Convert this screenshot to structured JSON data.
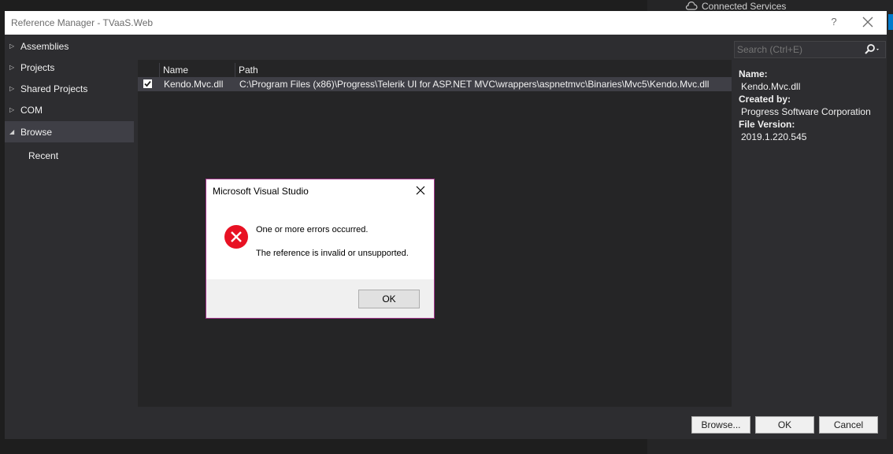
{
  "background": {
    "connected_services": "Connected Services"
  },
  "window": {
    "title": "Reference Manager - TVaaS.Web",
    "help": "?"
  },
  "nav": {
    "items": [
      {
        "label": "Assemblies",
        "expanded": false
      },
      {
        "label": "Projects",
        "expanded": false
      },
      {
        "label": "Shared Projects",
        "expanded": false
      },
      {
        "label": "COM",
        "expanded": false
      },
      {
        "label": "Browse",
        "expanded": true,
        "selected": true
      }
    ],
    "sub_items": [
      "Recent"
    ]
  },
  "list": {
    "columns": [
      "Name",
      "Path"
    ],
    "rows": [
      {
        "checked": true,
        "name": "Kendo.Mvc.dll",
        "path": "C:\\Program Files (x86)\\Progress\\Telerik UI for ASP.NET MVC\\wrappers\\aspnetmvc\\Binaries\\Mvc5\\Kendo.Mvc.dll"
      }
    ]
  },
  "search": {
    "placeholder": "Search (Ctrl+E)"
  },
  "details": {
    "name_label": "Name:",
    "name_value": "Kendo.Mvc.dll",
    "created_label": "Created by:",
    "created_value": "Progress Software Corporation",
    "version_label": "File Version:",
    "version_value": "2019.1.220.545"
  },
  "buttons": {
    "browse": "Browse...",
    "ok": "OK",
    "cancel": "Cancel"
  },
  "dialog": {
    "title": "Microsoft Visual Studio",
    "message1": "One or more errors occurred.",
    "message2": "The reference is invalid or unsupported.",
    "ok": "OK"
  },
  "colors": {
    "accent": "#007acc",
    "dialog_border": "#a4358c",
    "error": "#e81123"
  }
}
